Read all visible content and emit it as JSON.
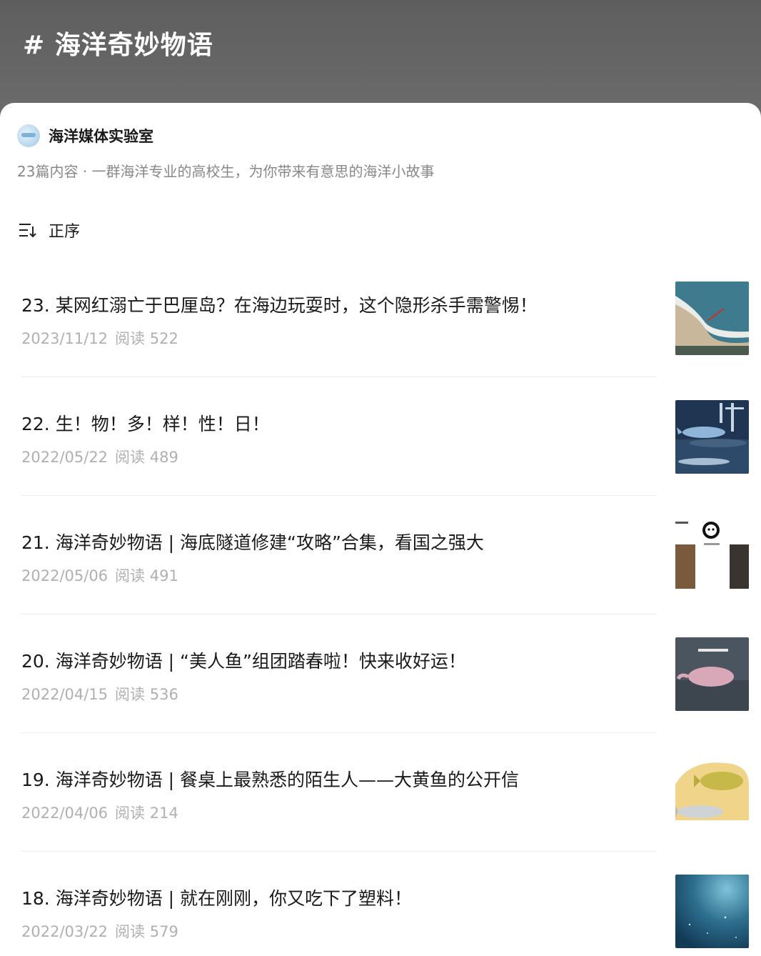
{
  "header": {
    "topic_title": "# 海洋奇妙物语"
  },
  "account": {
    "avatar": "ocean-media-lab-logo",
    "name": "海洋媒体实验室",
    "description": "23篇内容 · 一群海洋专业的高校生，为你带来有意思的海洋小故事"
  },
  "sort": {
    "icon": "sort-order-icon",
    "label": "正序"
  },
  "articles": [
    {
      "title": "23. 某网红溺亡于巴厘岛？在海边玩耍时，这个隐形杀手需警惕！",
      "date": "2023/11/12",
      "read": "阅读 522",
      "thumb": "beach-rip-current-aerial"
    },
    {
      "title": "22. 生！物！多！样！性！日！",
      "date": "2022/05/22",
      "read": "阅读 489",
      "thumb": "whale-night-sky"
    },
    {
      "title": "21. 海洋奇妙物语 | 海底隧道修建“攻略”合集，看国之强大",
      "date": "2022/05/06",
      "read": "阅读 491",
      "thumb": "tunnel-collage-panda-meme"
    },
    {
      "title": "20. 海洋奇妙物语 | “美人鱼”组团踏春啦！快来收好运！",
      "date": "2022/04/15",
      "read": "阅读 536",
      "thumb": "pink-dolphin-water"
    },
    {
      "title": "19. 海洋奇妙物语 | 餐桌上最熟悉的陌生人——大黄鱼的公开信",
      "date": "2022/04/06",
      "read": "阅读 214",
      "thumb": "yellow-croaker-fish"
    },
    {
      "title": "18. 海洋奇妙物语 | 就在刚刚，你又吃下了塑料！",
      "date": "2022/03/22",
      "read": "阅读 579",
      "thumb": "underwater-blue"
    }
  ]
}
